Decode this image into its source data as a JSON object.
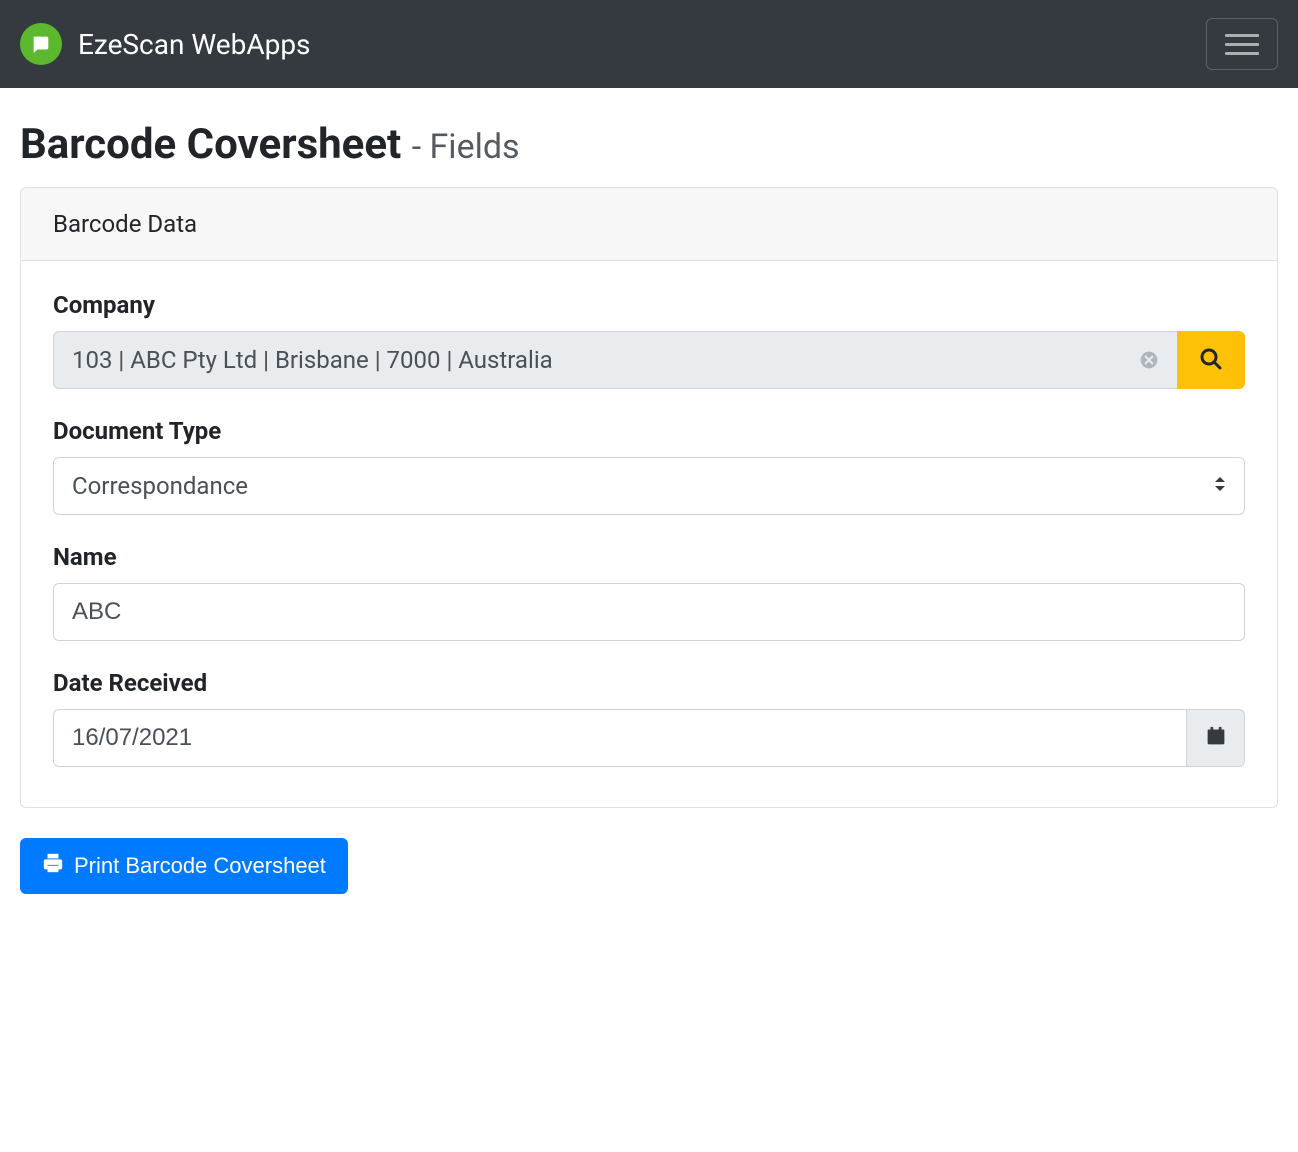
{
  "navbar": {
    "brand": "EzeScan WebApps"
  },
  "page": {
    "title_main": "Barcode Coversheet ",
    "title_sub": "- Fields"
  },
  "card": {
    "header": "Barcode Data"
  },
  "fields": {
    "company": {
      "label": "Company",
      "value": "103 | ABC Pty Ltd | Brisbane | 7000 | Australia"
    },
    "document_type": {
      "label": "Document Type",
      "value": "Correspondance"
    },
    "name": {
      "label": "Name",
      "value": "ABC"
    },
    "date_received": {
      "label": "Date Received",
      "value": "16/07/2021"
    }
  },
  "actions": {
    "print": "Print Barcode Coversheet"
  }
}
